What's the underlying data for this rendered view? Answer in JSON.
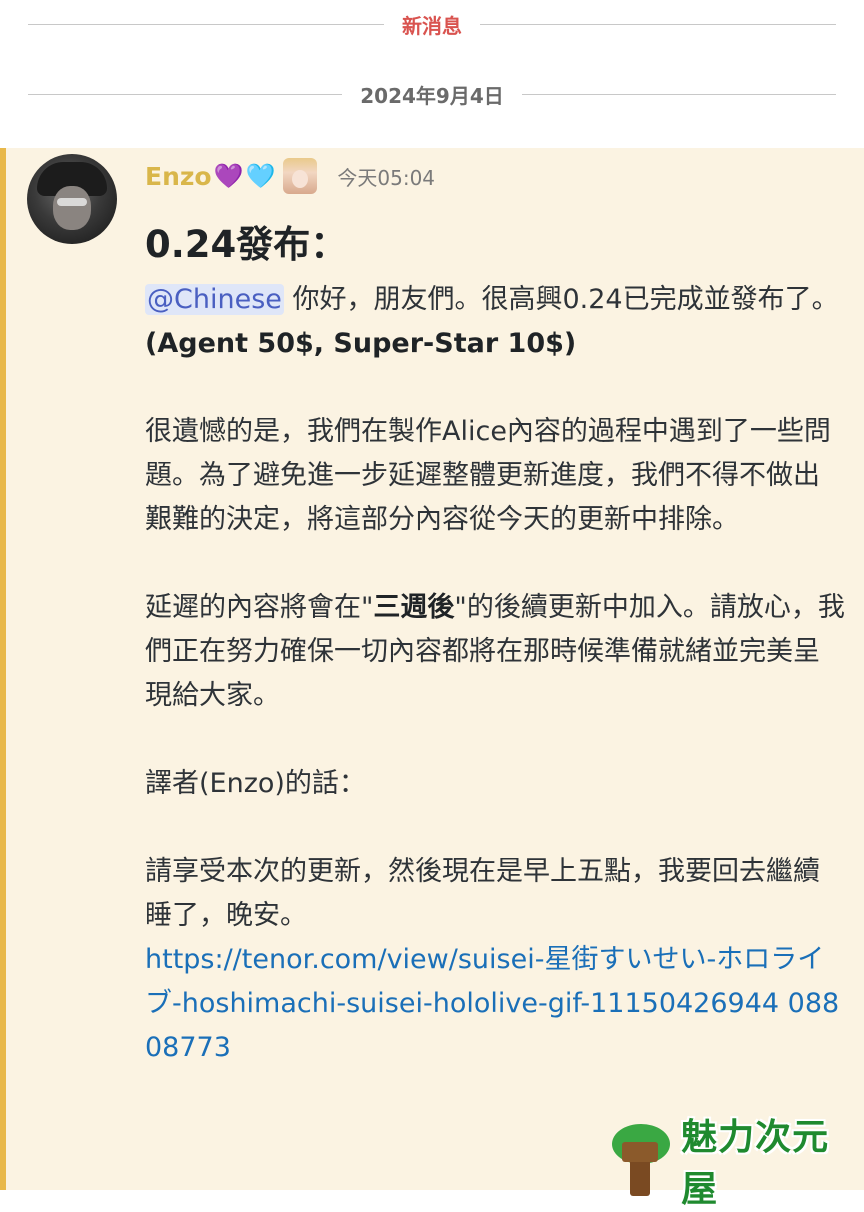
{
  "new_messages_label": "新消息",
  "date_label": "2024年9月4日",
  "message": {
    "username": "Enzo",
    "emoji_1": "💜",
    "emoji_2": "🩵",
    "timestamp": "今天05:04",
    "title": "0.24發布：",
    "mention": "@Chinese",
    "line1_rest": "你好，朋友們。很高興0.24已完成並發布了。",
    "line1_bold": "(Agent 50$, Super-Star 10$)",
    "para2": "很遺憾的是，我們在製作Alice內容的過程中遇到了一些問題。為了避免進一步延遲整體更新進度，我們不得不做出艱難的決定，將這部分內容從今天的更新中排除。",
    "para3_pre": "延遲的內容將會在\"",
    "para3_bold": "三週後",
    "para3_post": "\"的後續更新中加入。請放心，我們正在努力確保一切內容都將在那時候準備就緒並完美呈現給大家。",
    "para4": "譯者(Enzo)的話：",
    "para5": "請享受本次的更新，然後現在是早上五點，我要回去繼續睡了，晚安。",
    "link": "https://tenor.com/view/suisei-星街すいせい-ホロライブ-hoshimachi-suisei-hololive-gif-11150426944 08808773"
  },
  "watermark": {
    "text": "魅力次元屋",
    "icon": "treehouse-icon"
  },
  "colors": {
    "accent": "#e8b84a",
    "username": "#d9b64a",
    "new_label": "#d9534f",
    "link": "#1a6fb8",
    "mention_bg": "#dfe6f8"
  }
}
